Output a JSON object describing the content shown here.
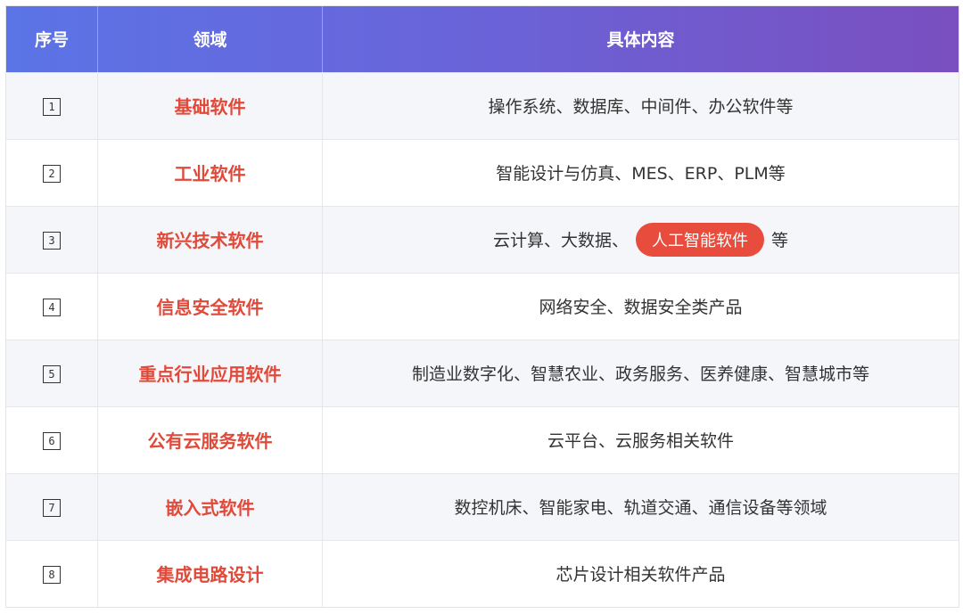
{
  "header": {
    "col_num": "序号",
    "col_field": "领域",
    "col_content": "具体内容"
  },
  "rows": [
    {
      "num": "1",
      "field": "基础软件",
      "content": "操作系统、数据库、中间件、办公软件等"
    },
    {
      "num": "2",
      "field": "工业软件",
      "content": "智能设计与仿真、MES、ERP、PLM等"
    },
    {
      "num": "3",
      "field": "新兴技术软件",
      "content_pre": "云计算、大数据、",
      "content_highlight": "人工智能软件",
      "content_post": "等"
    },
    {
      "num": "4",
      "field": "信息安全软件",
      "content": "网络安全、数据安全类产品"
    },
    {
      "num": "5",
      "field": "重点行业应用软件",
      "content": "制造业数字化、智慧农业、政务服务、医养健康、智慧城市等"
    },
    {
      "num": "6",
      "field": "公有云服务软件",
      "content": "云平台、云服务相关软件"
    },
    {
      "num": "7",
      "field": "嵌入式软件",
      "content": "数控机床、智能家电、轨道交通、通信设备等领域"
    },
    {
      "num": "8",
      "field": "集成电路设计",
      "content": "芯片设计相关软件产品"
    }
  ],
  "colors": {
    "header_gradient_start": "#5b74e6",
    "header_gradient_end": "#7a4fbf",
    "field_text": "#e04a3a",
    "highlight_pill": "#e84c3d"
  }
}
